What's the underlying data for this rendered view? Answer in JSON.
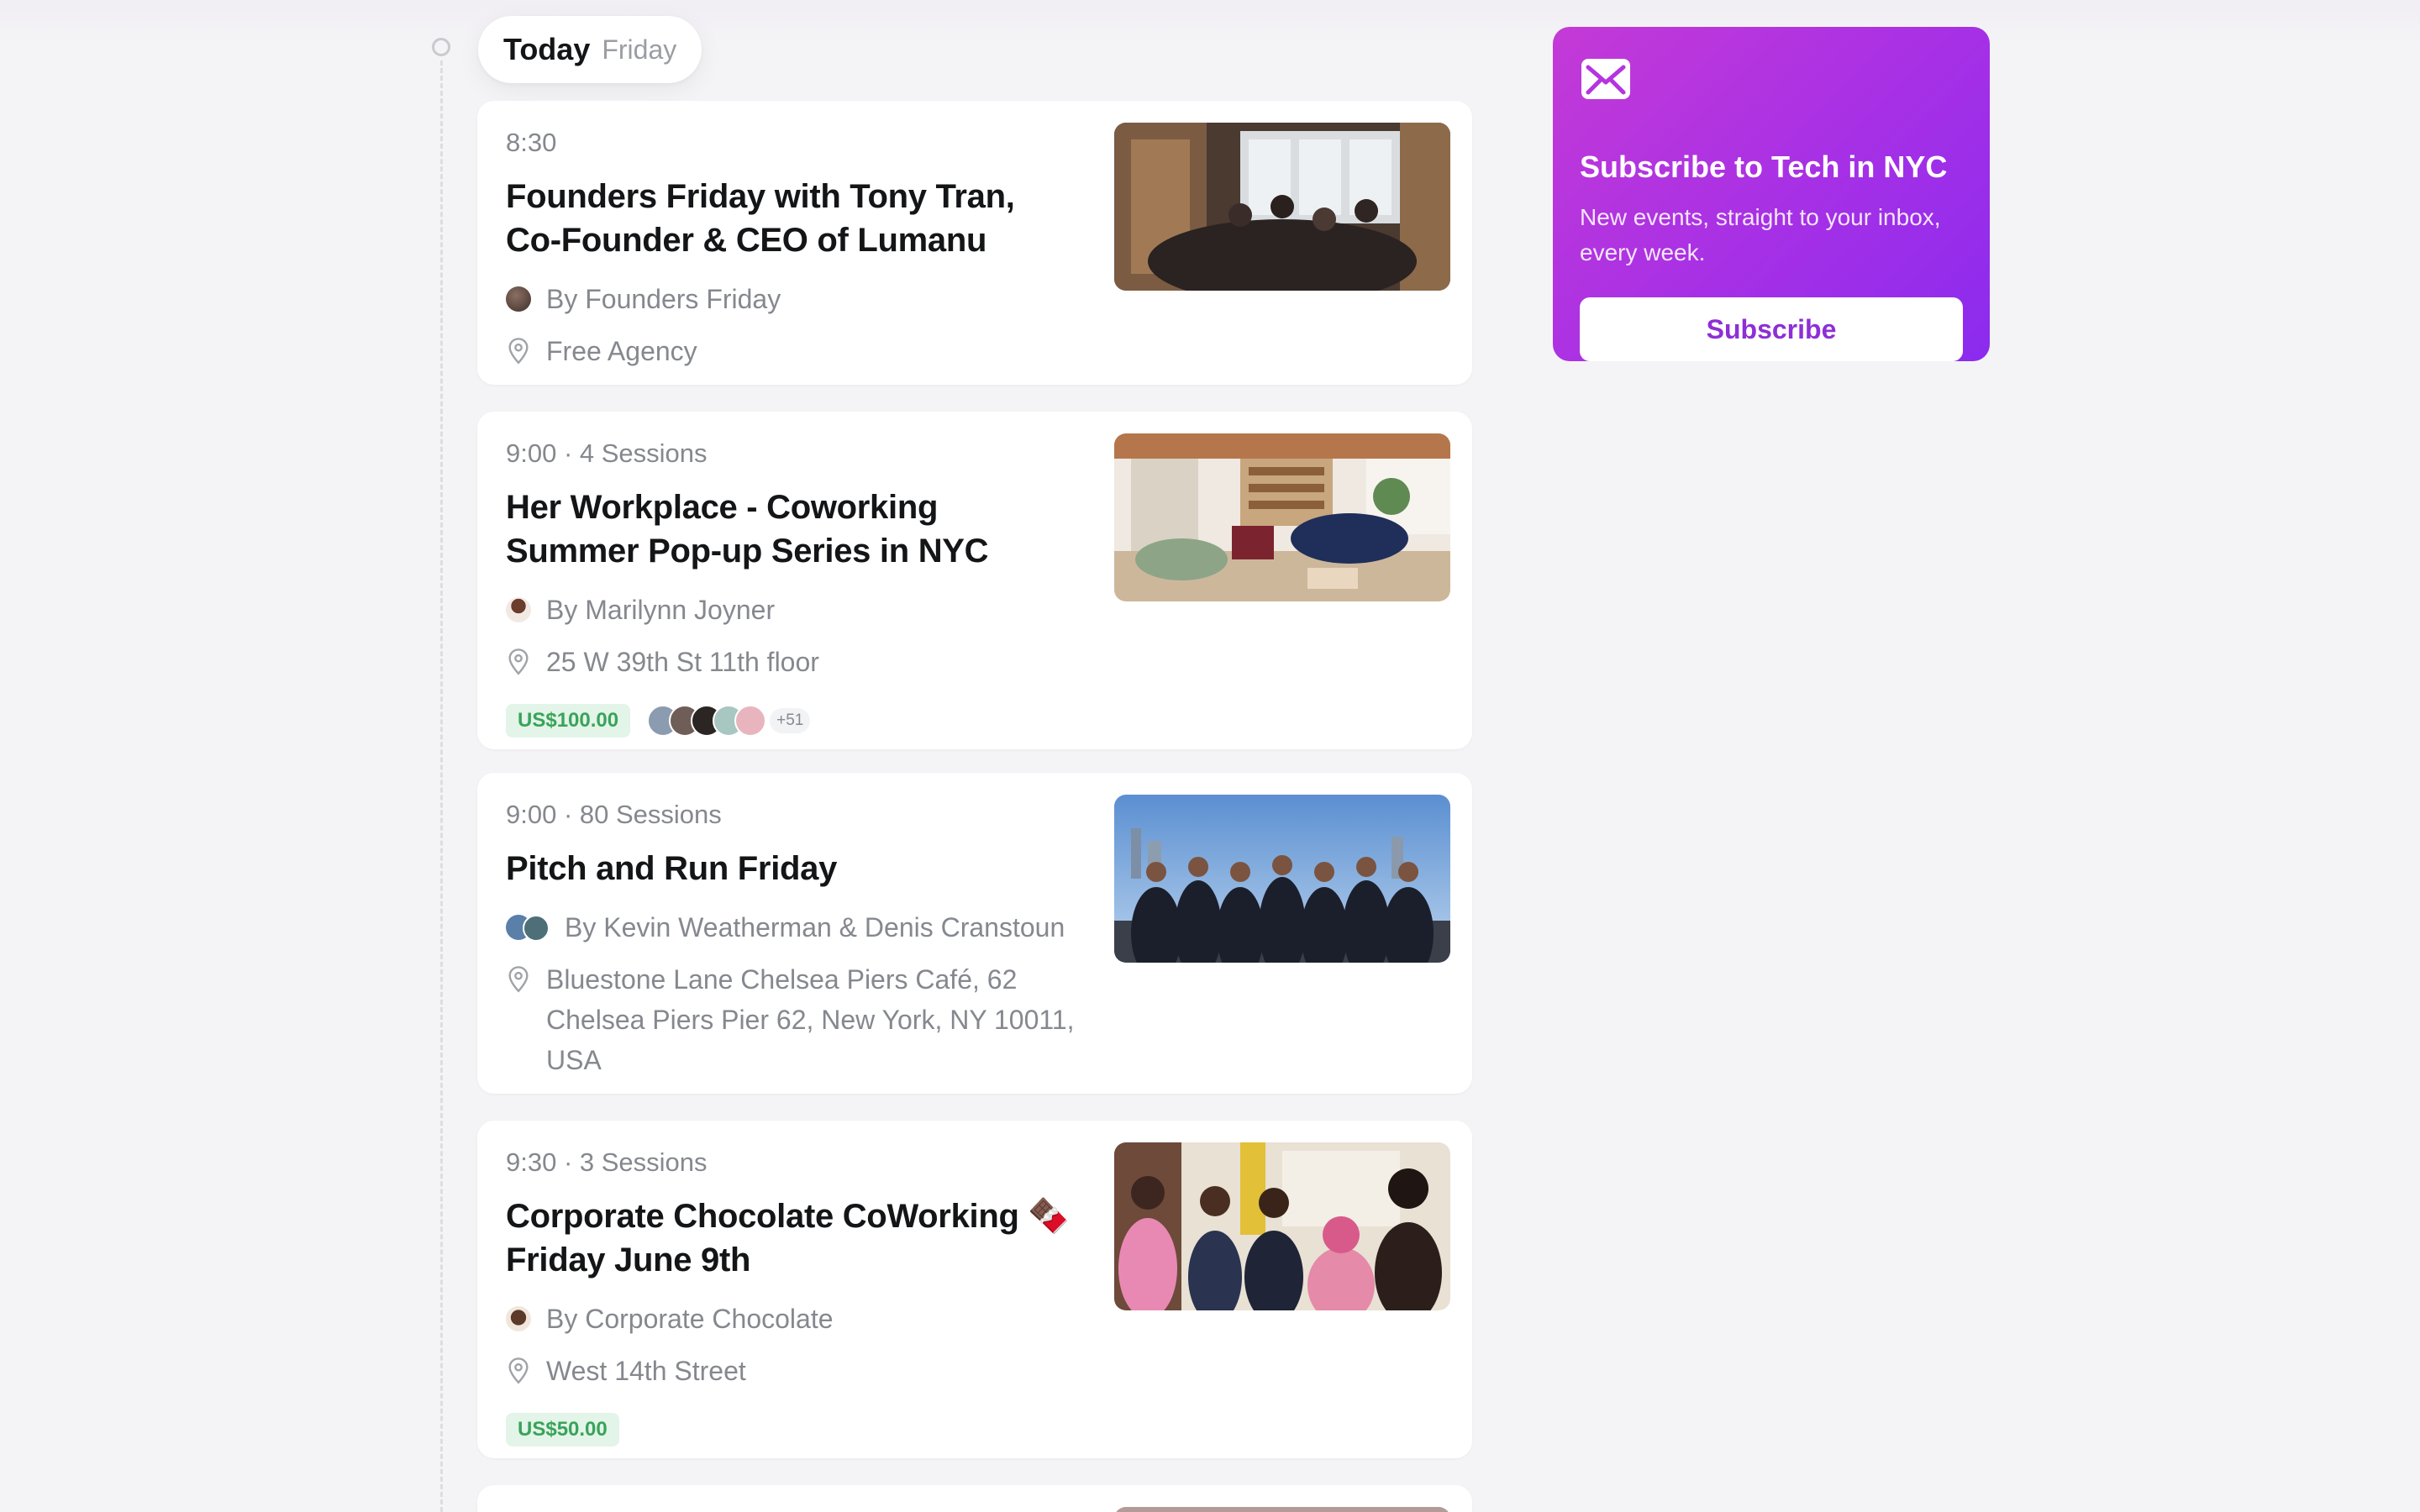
{
  "day": {
    "today": "Today",
    "weekday": "Friday"
  },
  "events": [
    {
      "time": "8:30",
      "title": "Founders Friday with Tony Tran, Co-Founder & CEO of Lumanu",
      "host": "By Founders Friday",
      "location": "Free Agency",
      "image": "photo of a crowded event room"
    },
    {
      "time": "9:00 · 4 Sessions",
      "title": "Her Workplace - Coworking Summer Pop-up Series in NYC",
      "host": "By Marilynn Joyner",
      "location": "25 W 39th St 11th floor",
      "price": "US$100.00",
      "attendee_count": "+51",
      "image": "photo of a coworking lounge"
    },
    {
      "time": "9:00 · 80 Sessions",
      "title": "Pitch and Run Friday",
      "host": "By Kevin Weatherman & Denis Cranstoun",
      "location": "Bluestone Lane Chelsea Piers Café, 62 Chelsea Piers Pier 62, New York, NY 10011, USA",
      "image": "group photo in front of skyline"
    },
    {
      "time": "9:30 · 3 Sessions",
      "title": "Corporate Chocolate CoWorking 🍫 Friday June 9th",
      "host": "By Corporate Chocolate",
      "location": "West 14th Street",
      "price": "US$50.00",
      "image": "group photo of smiling people"
    }
  ],
  "subscribe": {
    "title": "Subscribe to Tech in NYC",
    "description": "New events, straight to your inbox, every week.",
    "button": "Subscribe",
    "icon": "mail-icon"
  },
  "colors": {
    "accent": "#a630e6",
    "price_bg": "#e3f4e8",
    "price_text": "#3aa35a"
  }
}
